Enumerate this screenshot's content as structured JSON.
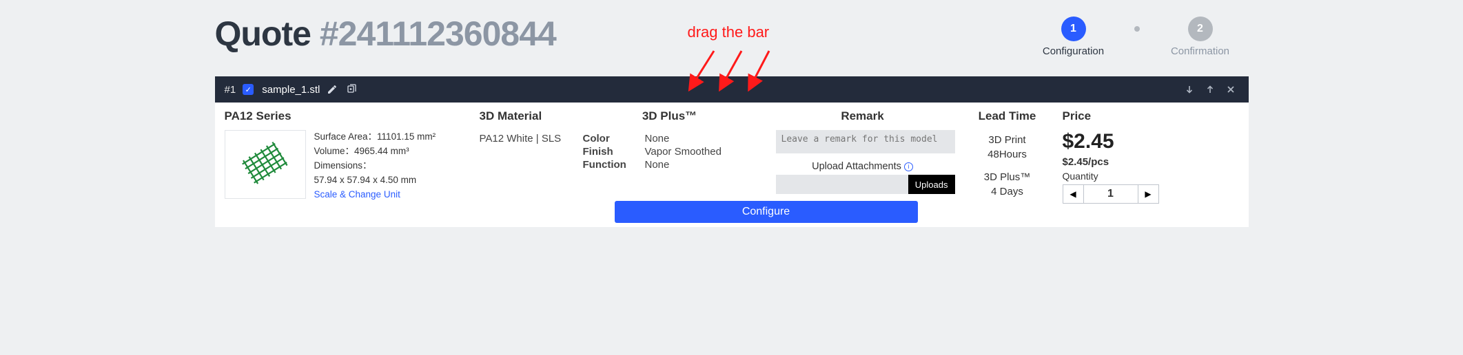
{
  "header": {
    "title_prefix": "Quote ",
    "quote_number": "#241112360844"
  },
  "annotation": {
    "text": "drag the bar"
  },
  "steps": {
    "s1": {
      "num": "1",
      "label": "Configuration"
    },
    "s2": {
      "num": "2",
      "label": "Confirmation"
    }
  },
  "item_bar": {
    "index": "#1",
    "filename": "sample_1.stl"
  },
  "columns": {
    "series": "PA12 Series",
    "material": "3D Material",
    "plus": "3D Plus™",
    "remark": "Remark",
    "lead": "Lead Time",
    "price": "Price"
  },
  "specs": {
    "surface_area_label": "Surface Area：",
    "surface_area_value": "11101.15 mm²",
    "volume_label": "Volume：",
    "volume_value": "4965.44 mm³",
    "dimensions_label": "Dimensions：",
    "dimensions_value": "57.94 x 57.94 x 4.50 mm",
    "scale_link": "Scale & Change Unit"
  },
  "material_value": "PA12 White | SLS",
  "plus_rows": {
    "color_k": "Color",
    "color_v": "None",
    "finish_k": "Finish",
    "finish_v": "Vapor Smoothed",
    "function_k": "Function",
    "function_v": "None"
  },
  "remark": {
    "placeholder": "Leave a remark for this model",
    "upload_label": "Upload Attachments",
    "uploads_btn": "Uploads"
  },
  "lead": {
    "l1a": "3D Print",
    "l1b": "48Hours",
    "l2a": "3D Plus™",
    "l2b": "4 Days"
  },
  "price": {
    "amount": "$2.45",
    "per": "$2.45/pcs",
    "qty_label": "Quantity",
    "qty_value": "1"
  },
  "configure_btn": "Configure"
}
